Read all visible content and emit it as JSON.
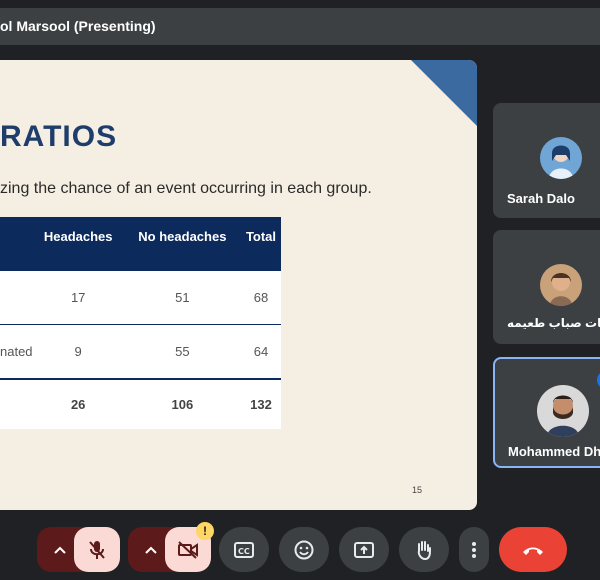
{
  "presenter": {
    "label": "ol Marsool (Presenting)"
  },
  "slide": {
    "title": "RATIOS",
    "subtitle": "zing the chance of an event occurring in each group.",
    "table": {
      "headers": [
        "Headaches",
        "No headaches",
        "Total"
      ],
      "rows": [
        {
          "label": "",
          "values": [
            "17",
            "51",
            "68"
          ]
        },
        {
          "label": "nated",
          "values": [
            "9",
            "55",
            "64"
          ]
        },
        {
          "label": "",
          "values": [
            "26",
            "106",
            "132"
          ]
        }
      ]
    },
    "page_number": "15"
  },
  "participants": [
    {
      "name": "Sarah Dalo"
    },
    {
      "name": "ب عيات صباب طعيمه"
    },
    {
      "name": "Mohammed Dh"
    }
  ],
  "controls": {
    "hand_badge": "!",
    "items": [
      "mic-options",
      "mic-muted",
      "camera-options",
      "camera-off",
      "captions",
      "reactions",
      "present",
      "raise-hand",
      "more-options",
      "leave-call"
    ]
  },
  "colors": {
    "background": "#202124",
    "slide_background": "#f5efe3",
    "title_color": "#1f3d6b",
    "table_header": "#0d2a5c",
    "leave_button": "#ea4335",
    "active_border": "#8ab4f8"
  }
}
